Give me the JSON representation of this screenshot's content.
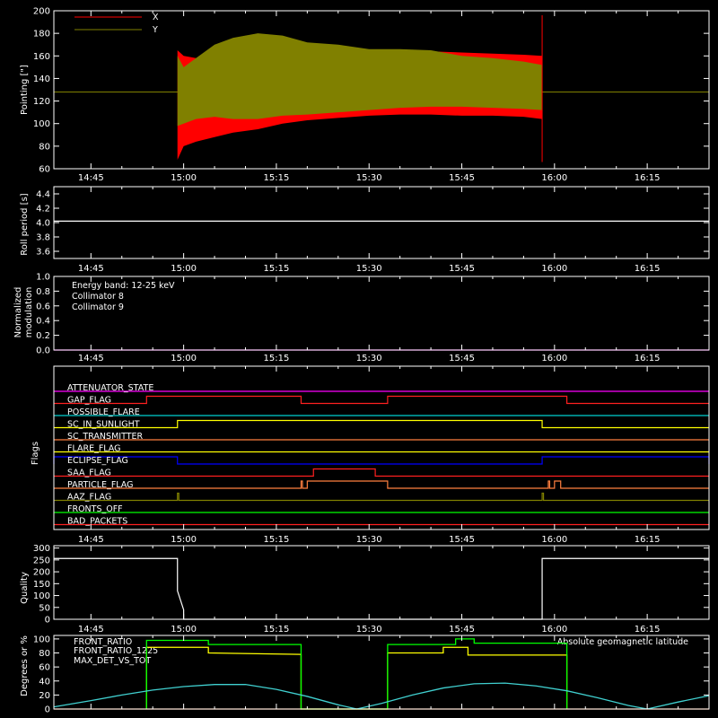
{
  "colors": {
    "background": "#000000",
    "axis": "#ffffff",
    "pointing_x": "#ff0000",
    "pointing_y": "#808000",
    "collimator_8": "#00ffff",
    "collimator_9": "#ff00ff",
    "front_ratio": "#ffff00",
    "front_ratio_1225": "#00ff00",
    "max_det_vs_tot": "#ff7f3f",
    "geomag_lat": "#40d0d0"
  },
  "chart_data": [
    {
      "id": "pointing",
      "type": "area",
      "ylabel": "Pointing [\"]",
      "xtick_labels": [
        "14:45",
        "15:00",
        "15:15",
        "15:30",
        "15:45",
        "16:00",
        "16:15"
      ],
      "ylim": [
        60,
        200
      ],
      "yticks": [
        60,
        80,
        100,
        120,
        140,
        160,
        180,
        200
      ],
      "legend": [
        "X",
        "Y"
      ],
      "baseline": 128,
      "series": [
        {
          "name": "X",
          "color": "#ff0000",
          "times": [
            "14:59",
            "15:00",
            "15:02",
            "15:05",
            "15:08",
            "15:12",
            "15:16",
            "15:20",
            "15:25",
            "15:30",
            "15:35",
            "15:40",
            "15:45",
            "15:50",
            "15:55",
            "15:58"
          ],
          "upper": [
            165,
            160,
            158,
            160,
            165,
            168,
            168,
            166,
            165,
            164,
            163,
            164,
            163,
            162,
            161,
            160
          ],
          "lower": [
            68,
            80,
            84,
            88,
            92,
            95,
            100,
            103,
            105,
            107,
            108,
            108,
            107,
            107,
            106,
            104
          ]
        },
        {
          "name": "Y",
          "color": "#808000",
          "times": [
            "14:59",
            "15:00",
            "15:02",
            "15:05",
            "15:08",
            "15:12",
            "15:16",
            "15:20",
            "15:25",
            "15:30",
            "15:35",
            "15:40",
            "15:45",
            "15:50",
            "15:55",
            "15:58"
          ],
          "upper": [
            160,
            150,
            158,
            170,
            176,
            180,
            178,
            172,
            170,
            166,
            166,
            165,
            160,
            158,
            155,
            152
          ],
          "lower": [
            98,
            100,
            104,
            106,
            104,
            104,
            107,
            108,
            110,
            112,
            114,
            115,
            115,
            114,
            113,
            112
          ]
        }
      ]
    },
    {
      "id": "roll",
      "type": "line",
      "ylabel": "Roll period [s]",
      "xtick_labels": [
        "14:45",
        "15:00",
        "15:15",
        "15:30",
        "15:45",
        "16:00",
        "16:15"
      ],
      "ylim": [
        3.5,
        4.5
      ],
      "yticks": [
        3.6,
        3.8,
        4.0,
        4.2,
        4.4
      ],
      "ytick_labels": [
        "3.6",
        "3.8",
        "4.0",
        "4.2",
        "4.4"
      ],
      "series": [
        {
          "color": "#ffffff",
          "y": 4.02
        }
      ]
    },
    {
      "id": "modulation",
      "type": "line",
      "ylabel_lines": [
        "Normalized",
        "modulation"
      ],
      "xtick_labels": [
        "14:45",
        "15:00",
        "15:15",
        "15:30",
        "15:45",
        "16:00",
        "16:15"
      ],
      "ylim": [
        0,
        1
      ],
      "yticks": [
        0,
        0.2,
        0.4,
        0.6,
        0.8,
        1.0
      ],
      "ytick_labels": [
        "0.0",
        "0.2",
        "0.4",
        "0.6",
        "0.8",
        "1.0"
      ],
      "annotations": [
        {
          "text": "Energy band: 12-25 keV",
          "color": "#ffffff"
        },
        {
          "text": "Collimator 8",
          "color": "#00ffff"
        },
        {
          "text": "Collimator 9",
          "color": "#ff00ff"
        }
      ],
      "series": [
        {
          "color": "#ff00ff",
          "y": 0.0
        }
      ]
    },
    {
      "id": "flags",
      "type": "line",
      "ylabel": "Flags",
      "xtick_labels": [
        "14:45",
        "15:00",
        "15:15",
        "15:30",
        "15:45",
        "16:00",
        "16:15"
      ],
      "flags": [
        {
          "name": "ATTENUATOR_STATE",
          "color": "#ff00ff",
          "segments": []
        },
        {
          "name": "GAP_FLAG",
          "color": "#ff2020",
          "segments": [
            [
              "14:54",
              "15:19"
            ],
            [
              "15:33",
              "16:02"
            ]
          ]
        },
        {
          "name": "POSSIBLE_FLARE",
          "color": "#00d0d0",
          "segments": []
        },
        {
          "name": "SC_IN_SUNLIGHT",
          "color": "#ffff00",
          "segments": [
            [
              "14:59",
              "15:58"
            ]
          ]
        },
        {
          "name": "SC_TRANSMITTER",
          "color": "#ff7f3f",
          "segments": []
        },
        {
          "name": "FLARE_FLAG",
          "color": "#ffff00",
          "segments": []
        },
        {
          "name": "ECLIPSE_FLAG",
          "color": "#0000ff",
          "segments": [
            [
              "14:39",
              "14:59"
            ],
            [
              "15:58",
              "16:25"
            ]
          ]
        },
        {
          "name": "SAA_FLAG",
          "color": "#ff2020",
          "segments": [
            [
              "15:21",
              "15:31"
            ]
          ]
        },
        {
          "name": "PARTICLE_FLAG",
          "color": "#ff7f3f",
          "segments": [
            [
              "15:19",
              "15:19"
            ],
            [
              "15:20",
              "15:33"
            ],
            [
              "15:59",
              "15:59"
            ],
            [
              "16:00",
              "16:01"
            ]
          ]
        },
        {
          "name": "AAZ_FLAG",
          "color": "#808000",
          "segments": [
            [
              "14:59",
              "14:59"
            ],
            [
              "15:58",
              "15:58"
            ]
          ]
        },
        {
          "name": "FRONTS_OFF",
          "color": "#00ff00",
          "segments": []
        },
        {
          "name": "BAD_PACKETS",
          "color": "#ff2020",
          "segments": []
        }
      ]
    },
    {
      "id": "quality",
      "type": "line",
      "ylabel": "Quality",
      "xtick_labels": [
        "14:45",
        "15:00",
        "15:15",
        "15:30",
        "15:45",
        "16:00",
        "16:15"
      ],
      "ylim": [
        0,
        310
      ],
      "yticks": [
        0,
        50,
        100,
        150,
        200,
        250,
        300
      ],
      "series": [
        {
          "color": "#ffffff",
          "times": [
            "14:39",
            "14:59",
            "14:59",
            "15:00",
            "15:00",
            "15:58",
            "15:58",
            "16:25"
          ],
          "y": [
            256,
            256,
            120,
            40,
            0,
            0,
            256,
            256
          ]
        }
      ]
    },
    {
      "id": "ratios",
      "type": "line",
      "ylabel": "Degrees or %",
      "xtick_labels": [
        "14:45",
        "15:00",
        "15:15",
        "15:30",
        "15:45",
        "16:00",
        "16:15"
      ],
      "ylim": [
        0,
        105
      ],
      "yticks": [
        0,
        20,
        40,
        60,
        80,
        100
      ],
      "legend": [
        "FRONT_RATIO",
        "FRONT_RATIO_1225",
        "MAX_DET_VS_TOT",
        "Absolute geomagnetic latitude"
      ],
      "series": [
        {
          "name": "FRONT_RATIO",
          "color": "#ffff00",
          "times": [
            "14:54",
            "14:54",
            "15:04",
            "15:04",
            "15:19",
            "15:19",
            "15:33",
            "15:33",
            "15:42",
            "15:42",
            "15:46",
            "15:46",
            "16:02",
            "16:02"
          ],
          "y": [
            0,
            88,
            88,
            80,
            78,
            0,
            0,
            80,
            80,
            88,
            88,
            77,
            77,
            0
          ]
        },
        {
          "name": "FRONT_RATIO_1225",
          "color": "#00ff00",
          "times": [
            "14:54",
            "14:54",
            "15:04",
            "15:04",
            "15:19",
            "15:19",
            "15:33",
            "15:33",
            "15:44",
            "15:44",
            "15:47",
            "15:47",
            "16:02",
            "16:02"
          ],
          "y": [
            0,
            98,
            98,
            92,
            92,
            0,
            0,
            92,
            92,
            100,
            100,
            94,
            94,
            0
          ]
        },
        {
          "name": "MAX_DET_VS_TOT",
          "color": "#ff7f3f",
          "times": [
            "14:39",
            "16:25"
          ],
          "y": [
            0,
            0
          ]
        },
        {
          "name": "Absolute geomagnetic latitude",
          "color": "#40d0d0",
          "times": [
            "14:39",
            "14:45",
            "14:50",
            "14:55",
            "15:00",
            "15:05",
            "15:10",
            "15:15",
            "15:20",
            "15:25",
            "15:28",
            "15:32",
            "15:37",
            "15:42",
            "15:47",
            "15:52",
            "15:57",
            "16:02",
            "16:07",
            "16:12",
            "16:15",
            "16:20",
            "16:25"
          ],
          "y": [
            3,
            12,
            20,
            27,
            32,
            35,
            35,
            28,
            18,
            6,
            0,
            8,
            20,
            30,
            36,
            37,
            33,
            26,
            16,
            5,
            0,
            10,
            19
          ]
        }
      ]
    }
  ]
}
